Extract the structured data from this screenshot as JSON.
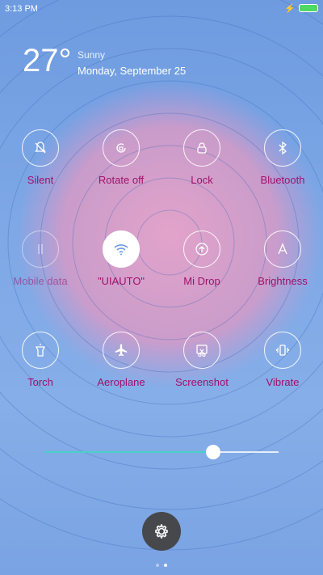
{
  "status_bar": {
    "time": "3:13 PM",
    "battery_color": "#4cd964"
  },
  "weather": {
    "temperature": "27°",
    "condition": "Sunny",
    "date": "Monday, September 25"
  },
  "tiles": [
    {
      "label": "Silent",
      "icon": "bell-off-icon"
    },
    {
      "label": "Rotate off",
      "icon": "rotate-lock-icon"
    },
    {
      "label": "Lock",
      "icon": "lock-icon"
    },
    {
      "label": "Bluetooth",
      "icon": "bluetooth-icon"
    },
    {
      "label": "Mobile data",
      "icon": "mobile-data-icon"
    },
    {
      "label": "\"UIAUTO\"",
      "icon": "wifi-icon"
    },
    {
      "label": "Mi Drop",
      "icon": "mi-drop-icon"
    },
    {
      "label": "Brightness",
      "icon": "brightness-auto-icon"
    },
    {
      "label": "Torch",
      "icon": "torch-icon"
    },
    {
      "label": "Aeroplane",
      "icon": "airplane-icon"
    },
    {
      "label": "Screenshot",
      "icon": "screenshot-icon"
    },
    {
      "label": "Vibrate",
      "icon": "vibrate-icon"
    }
  ],
  "brightness": {
    "level": 0.72,
    "accent": "#4bd0c8"
  },
  "label_color": "#a0106a"
}
